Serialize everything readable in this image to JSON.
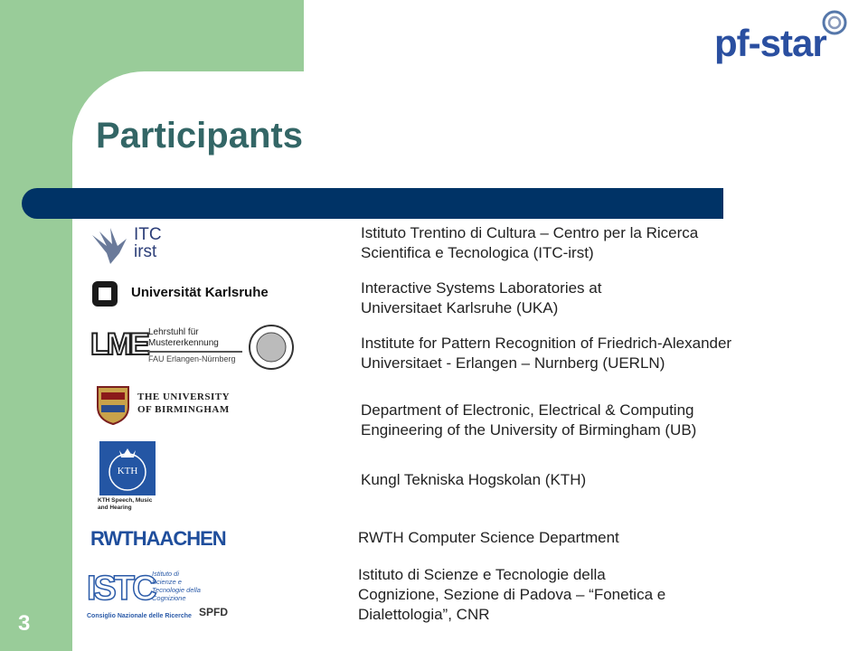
{
  "header": {
    "logo_text": "pf-star"
  },
  "slide": {
    "title": "Participants",
    "page_number": "3"
  },
  "participants": [
    {
      "text": "Istituto Trentino di Cultura – Centro per la Ricerca\nScientifica e Tecnologica (ITC-irst)",
      "logo_text": "ITC\nirst"
    },
    {
      "text": "Interactive Systems Laboratories at\nUniversitaet Karlsruhe (UKA)",
      "logo_text": "Universität Karlsruhe"
    },
    {
      "text": "Institute for Pattern Recognition of Friedrich-Alexander\nUniversitaet - Erlangen – Nurnberg (UERLN)",
      "logo_text": "LME",
      "logo_subtext": "Lehrstuhl für\nMustererkennung",
      "logo_caption": "FAU Erlangen-Nürnberg"
    },
    {
      "text": "Department of Electronic, Electrical & Computing\nEngineering of the University of Birmingham (UB)",
      "logo_text": "THE UNIVERSITY\nOF BIRMINGHAM"
    },
    {
      "text": "Kungl Tekniska Hogskolan (KTH)",
      "logo_text": "KTH",
      "logo_caption": "KTH Speech, Music\nand Hearing"
    },
    {
      "text": "RWTH Computer Science Department",
      "logo_text": "RWTHAACHEN"
    },
    {
      "text": "Istituto di Scienze e Tecnologie della\nCognizione, Sezione di Padova – “Fonetica e\nDialettologia”, CNR",
      "logo_text": "ISTC",
      "logo_subtext": "Istituto di\nScienze e\nTecnologie della\nCognizione",
      "logo_caption": "Consiglio Nazionale delle Ricerche",
      "logo_badge": "SPFD"
    }
  ]
}
